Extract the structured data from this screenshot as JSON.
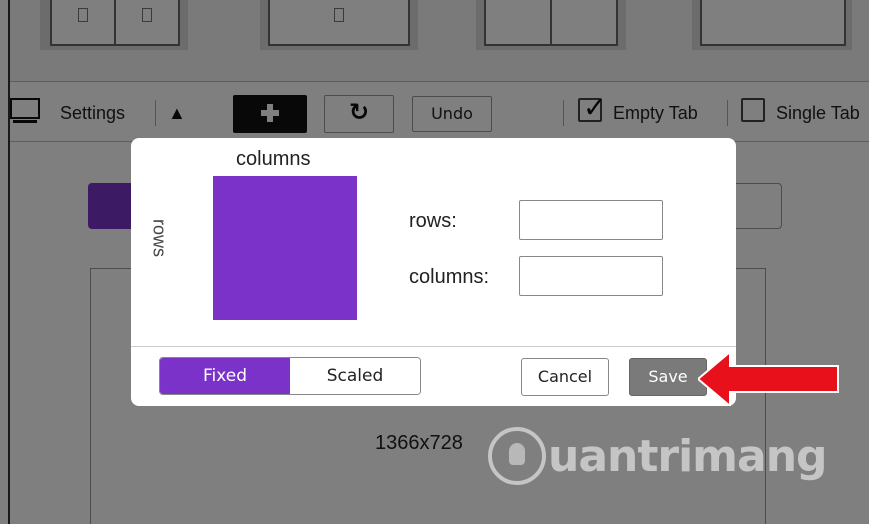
{
  "toolbar": {
    "settings_label": "Settings",
    "undo_label": "Undo",
    "empty_tab": {
      "label": "Empty Tab",
      "checked": true
    },
    "single_tab": {
      "label": "Single Tab",
      "checked": false
    }
  },
  "canvas": {
    "resolution": "1366x728"
  },
  "modal": {
    "columns_heading": "columns",
    "rows_heading": "rows",
    "preview_color": "#7b32c9",
    "rows_field_label": "rows:",
    "rows_value": "",
    "columns_field_label": "columns:",
    "columns_value": "",
    "mode_fixed": "Fixed",
    "mode_scaled": "Scaled",
    "selected_mode": "Fixed",
    "cancel_label": "Cancel",
    "save_label": "Save"
  },
  "annotation": {
    "arrow_color": "#e8101a",
    "points_to": "save-button"
  },
  "watermark": {
    "text": "uantrimang",
    "icon": "lightbulb-icon"
  },
  "colors": {
    "accent": "#7b32c9",
    "overlay": "rgba(0,0,0,0.5)"
  }
}
